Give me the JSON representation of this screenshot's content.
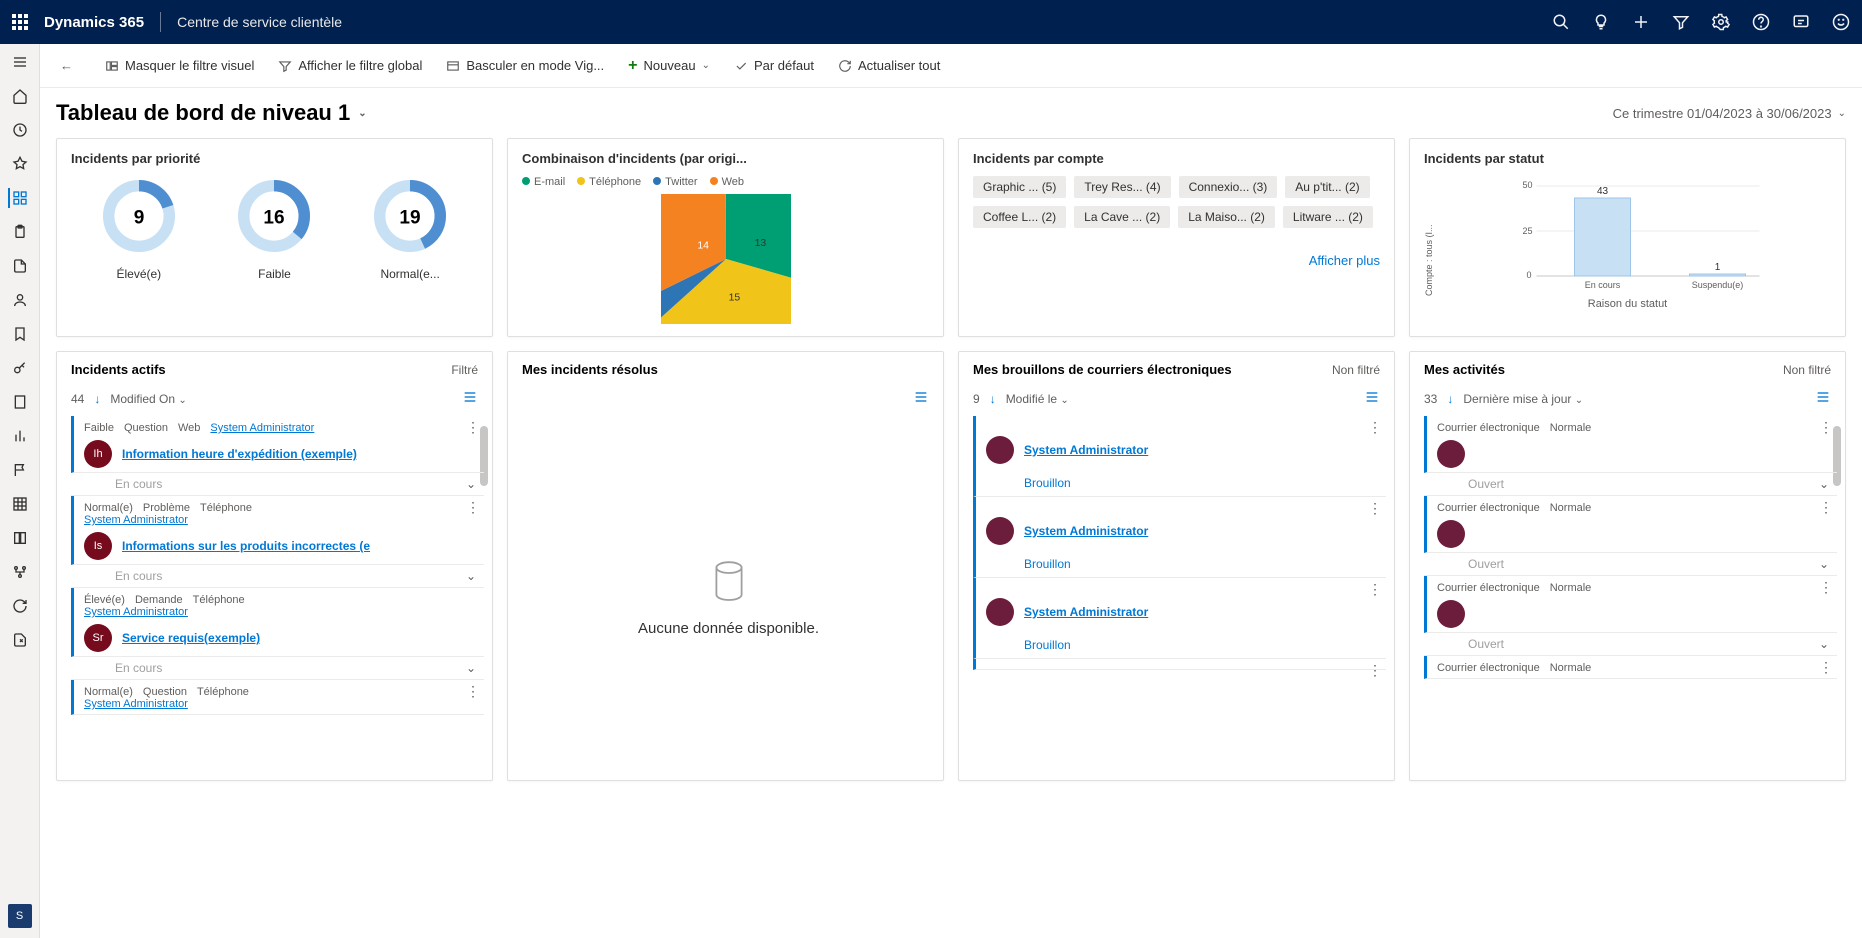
{
  "topbar": {
    "brand": "Dynamics 365",
    "app_name": "Centre de service clientèle"
  },
  "cmdbar": {
    "hide_visual_filter": "Masquer le filtre visuel",
    "show_global_filter": "Afficher le filtre global",
    "toggle_view": "Basculer en mode Vig...",
    "new": "Nouveau",
    "default": "Par défaut",
    "refresh_all": "Actualiser tout"
  },
  "page": {
    "title": "Tableau de bord de niveau 1",
    "date_range": "Ce trimestre 01/04/2023 à 30/06/2023"
  },
  "cards": {
    "priority": {
      "title": "Incidents par priorité",
      "items": [
        {
          "value": "9",
          "label": "Élevé(e)"
        },
        {
          "value": "16",
          "label": "Faible"
        },
        {
          "value": "19",
          "label": "Normal(e..."
        }
      ]
    },
    "origin": {
      "title": "Combinaison d'incidents (par origi...",
      "legend": [
        {
          "label": "E-mail",
          "color": "#009e73"
        },
        {
          "label": "Téléphone",
          "color": "#f0c419"
        },
        {
          "label": "Twitter",
          "color": "#2e75b6"
        },
        {
          "label": "Web",
          "color": "#f58220"
        }
      ],
      "slices": {
        "email": "13",
        "phone": "15",
        "twitter": "2",
        "web": "14"
      }
    },
    "account": {
      "title": "Incidents par compte",
      "tags": [
        "Graphic ... (5)",
        "Trey Res... (4)",
        "Connexio... (3)",
        "Au p'tit... (2)",
        "Coffee L... (2)",
        "La Cave ... (2)",
        "La Maiso... (2)",
        "Litware ... (2)"
      ],
      "show_more": "Afficher plus"
    },
    "status": {
      "title": "Incidents par statut",
      "y_axis": "Compte : tous (I...",
      "x_axis": "Raison du statut",
      "ticks": [
        "50",
        "25",
        "0"
      ],
      "bars": [
        {
          "label": "En cours",
          "value": "43"
        },
        {
          "label": "Suspendu(e)",
          "value": "1"
        }
      ]
    }
  },
  "chart_data": [
    {
      "type": "pie",
      "title": "Incidents par priorité",
      "series": [
        {
          "name": "Élevé(e)",
          "values": [
            9
          ]
        },
        {
          "name": "Faible",
          "values": [
            16
          ]
        },
        {
          "name": "Normal(e)",
          "values": [
            19
          ]
        }
      ]
    },
    {
      "type": "pie",
      "title": "Combinaison d'incidents (par origine)",
      "categories": [
        "E-mail",
        "Téléphone",
        "Twitter",
        "Web"
      ],
      "values": [
        13,
        15,
        2,
        14
      ]
    },
    {
      "type": "bar",
      "title": "Incidents par statut",
      "xlabel": "Raison du statut",
      "ylabel": "Compte : tous (Incidents)",
      "ylim": [
        0,
        50
      ],
      "categories": [
        "En cours",
        "Suspendu(e)"
      ],
      "values": [
        43,
        1
      ]
    }
  ],
  "streams": {
    "active": {
      "title": "Incidents actifs",
      "filter": "Filtré",
      "count": "44",
      "sort": "Modified On",
      "status_label": "En cours",
      "items": [
        {
          "meta": [
            "Faible",
            "Question",
            "Web"
          ],
          "owner": "System Administrator",
          "initials": "Ih",
          "title": "Information heure d'expédition (exemple)"
        },
        {
          "meta": [
            "Normal(e)",
            "Problème",
            "Téléphone"
          ],
          "owner": "System Administrator",
          "initials": "Is",
          "title": "Informations sur les produits incorrectes (e"
        },
        {
          "meta": [
            "Élevé(e)",
            "Demande",
            "Téléphone"
          ],
          "owner": "System Administrator",
          "initials": "Sr",
          "title": "Service requis(exemple)"
        },
        {
          "meta": [
            "Normal(e)",
            "Question",
            "Téléphone"
          ],
          "owner": "System Administrator",
          "initials": "",
          "title": ""
        }
      ]
    },
    "resolved": {
      "title": "Mes incidents résolus",
      "empty_msg": "Aucune donnée disponible."
    },
    "drafts": {
      "title": "Mes brouillons de courriers électroniques",
      "filter": "Non filtré",
      "count": "9",
      "sort": "Modifié le",
      "status_label": "Brouillon",
      "owner": "System Administrator"
    },
    "activities": {
      "title": "Mes activités",
      "filter": "Non filtré",
      "count": "33",
      "sort": "Dernière mise à jour",
      "meta_type": "Courrier électronique",
      "meta_priority": "Normale",
      "status_label": "Ouvert"
    }
  },
  "nav_avatar": "S"
}
